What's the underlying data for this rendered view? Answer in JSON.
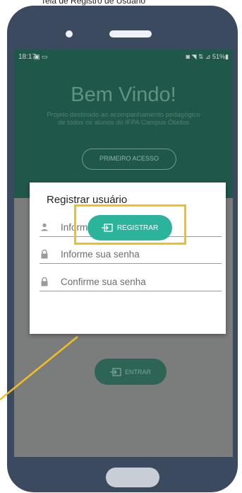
{
  "caption": {
    "text": "Tela de Registro de Usuário"
  },
  "status_bar": {
    "time": "18:17",
    "left_icons": "▣ ▭",
    "right_icons": "◙ ◥ ⇅ ⊿ 51%▮"
  },
  "app": {
    "title": "Bem Vindo!",
    "subtitle": "Projeto destinado ao acompanhamento pedagógico de todos os alunos do IFPA Campus Óbidos",
    "first_access_label": "PRIMEIRO ACESSO",
    "enter_label": "ENTRAR"
  },
  "dialog": {
    "title": "Registrar usuário",
    "cpf_placeholder": "Informe seu cpf",
    "password_placeholder": "Informe sua senha",
    "confirm_placeholder": "Confirme sua senha",
    "register_label": "REGISTRAR"
  },
  "colors": {
    "primary_dark": "#1f584b",
    "accent": "#2bb39b",
    "highlight": "#f2c01e",
    "phone_body": "#3b4a5f"
  },
  "icons": {
    "cpf": "person-icon",
    "password": "lock-icon",
    "confirm": "lock-icon",
    "register": "login-icon",
    "enter": "login-icon"
  }
}
